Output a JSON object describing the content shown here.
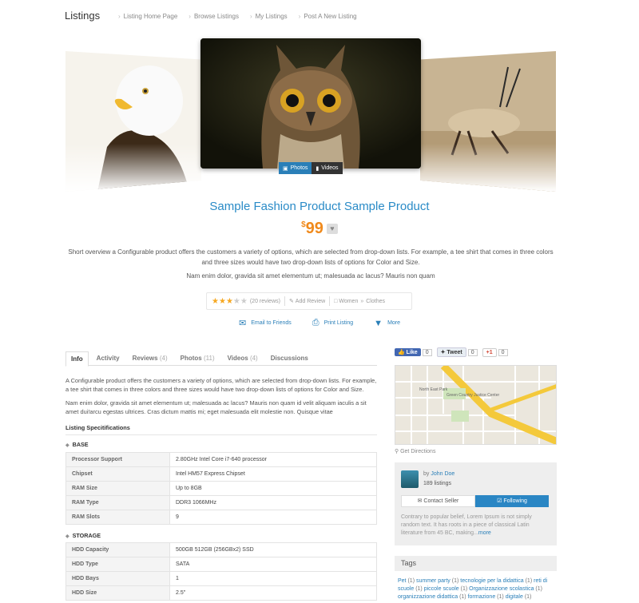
{
  "header": {
    "brand": "Listings",
    "nav": [
      "Listing Home Page",
      "Browse Listings",
      "My Listings",
      "Post A New Listing"
    ]
  },
  "gallery": {
    "tabs": [
      {
        "label": "Photos",
        "icon": "photo-icon",
        "active": true
      },
      {
        "label": "Videos",
        "icon": "video-icon",
        "active": false
      }
    ]
  },
  "product": {
    "title": "Sample Fashion Product Sample Product",
    "currency": "$",
    "price": "99",
    "overview": [
      "Short overview a Configurable product offers the customers a variety of options, which are selected from drop-down lists. For example, a tee shirt that comes in three colors and three sizes would have two drop-down lists of options for Color and Size.",
      "Nam enim dolor, gravida sit amet elementum ut; malesuada ac lacus? Mauris non quam"
    ]
  },
  "meta": {
    "rating": 3,
    "rating_max": 5,
    "reviews": "(20 reviews)",
    "add_review": "Add Review",
    "category": "Women",
    "subcategory": "Clothes"
  },
  "actions": {
    "email": "Email to Friends",
    "print": "Print Listing",
    "more": "More"
  },
  "tabs": [
    {
      "label": "Info",
      "count": ""
    },
    {
      "label": "Activity",
      "count": ""
    },
    {
      "label": "Reviews",
      "count": "(4)"
    },
    {
      "label": "Photos",
      "count": "(11)"
    },
    {
      "label": "Videos",
      "count": "(4)"
    },
    {
      "label": "Discussions",
      "count": ""
    }
  ],
  "info": {
    "paragraphs": [
      "A Configurable product offers the customers a variety of options, which are selected from drop-down lists. For example, a tee shirt that comes in three colors and three sizes would have two drop-down lists of options for Color and Size.",
      "Nam enim dolor, gravida sit amet elementum ut; malesuada ac lacus? Mauris non quam id velit aliquam iaculis a sit amet dui!arcu egestas ultrices. Cras dictum mattis mi; eget malesuada elit molestie non. Quisque vitae"
    ],
    "spec_title": "Listing Specitifications",
    "groups": [
      {
        "name": "BASE",
        "rows": [
          [
            "Processor Support",
            "2.80GHz Intel Core i7-640 processor"
          ],
          [
            "Chipset",
            "Intel HM57 Express Chipset"
          ],
          [
            "RAM Size",
            "Up to 8GB"
          ],
          [
            "RAM Type",
            "DDR3 1066MHz"
          ],
          [
            "RAM Slots",
            "9"
          ]
        ]
      },
      {
        "name": "STORAGE",
        "rows": [
          [
            "HDD Capacity",
            "500GB 512GB (256GBx2) SSD"
          ],
          [
            "HDD Type",
            "SATA"
          ],
          [
            "HDD Bays",
            "1"
          ],
          [
            "HDD Size",
            "2.5\""
          ]
        ]
      }
    ]
  },
  "social": {
    "like": "Like",
    "like_count": "0",
    "tweet": "Tweet",
    "tweet_count": "0",
    "gplus": "+1",
    "gplus_count": "0"
  },
  "map": {
    "label_park": "North East Park",
    "label_center": "Green Country Justice Center",
    "get_directions": "Get Directions"
  },
  "seller": {
    "by": "by",
    "name": "John Doe",
    "listings": "189 listings",
    "contact": "Contact Seller",
    "follow": "Following",
    "bio": "Contrary to popular belief, Lorem Ipsum is not simply random text. It has roots in a piece of classical Latin literature from 45 BC, making...",
    "more": "more"
  },
  "tags": {
    "title": "Tags",
    "items": [
      {
        "name": "Pet",
        "count": "(1)"
      },
      {
        "name": "summer party",
        "count": "(1)"
      },
      {
        "name": "tecnologie per la didattica",
        "count": "(1)"
      },
      {
        "name": "reti di scuole",
        "count": "(1)"
      },
      {
        "name": "piccole scuole",
        "count": "(1)"
      },
      {
        "name": "Organizzazione scolastica",
        "count": "(1)"
      },
      {
        "name": "organizzazione didattica",
        "count": "(1)"
      },
      {
        "name": "formazione",
        "count": "(1)"
      },
      {
        "name": "digitale",
        "count": "(1)"
      }
    ]
  },
  "colors": {
    "accent": "#2a8bc7",
    "price": "#f08a1c",
    "star": "#f6a821"
  }
}
